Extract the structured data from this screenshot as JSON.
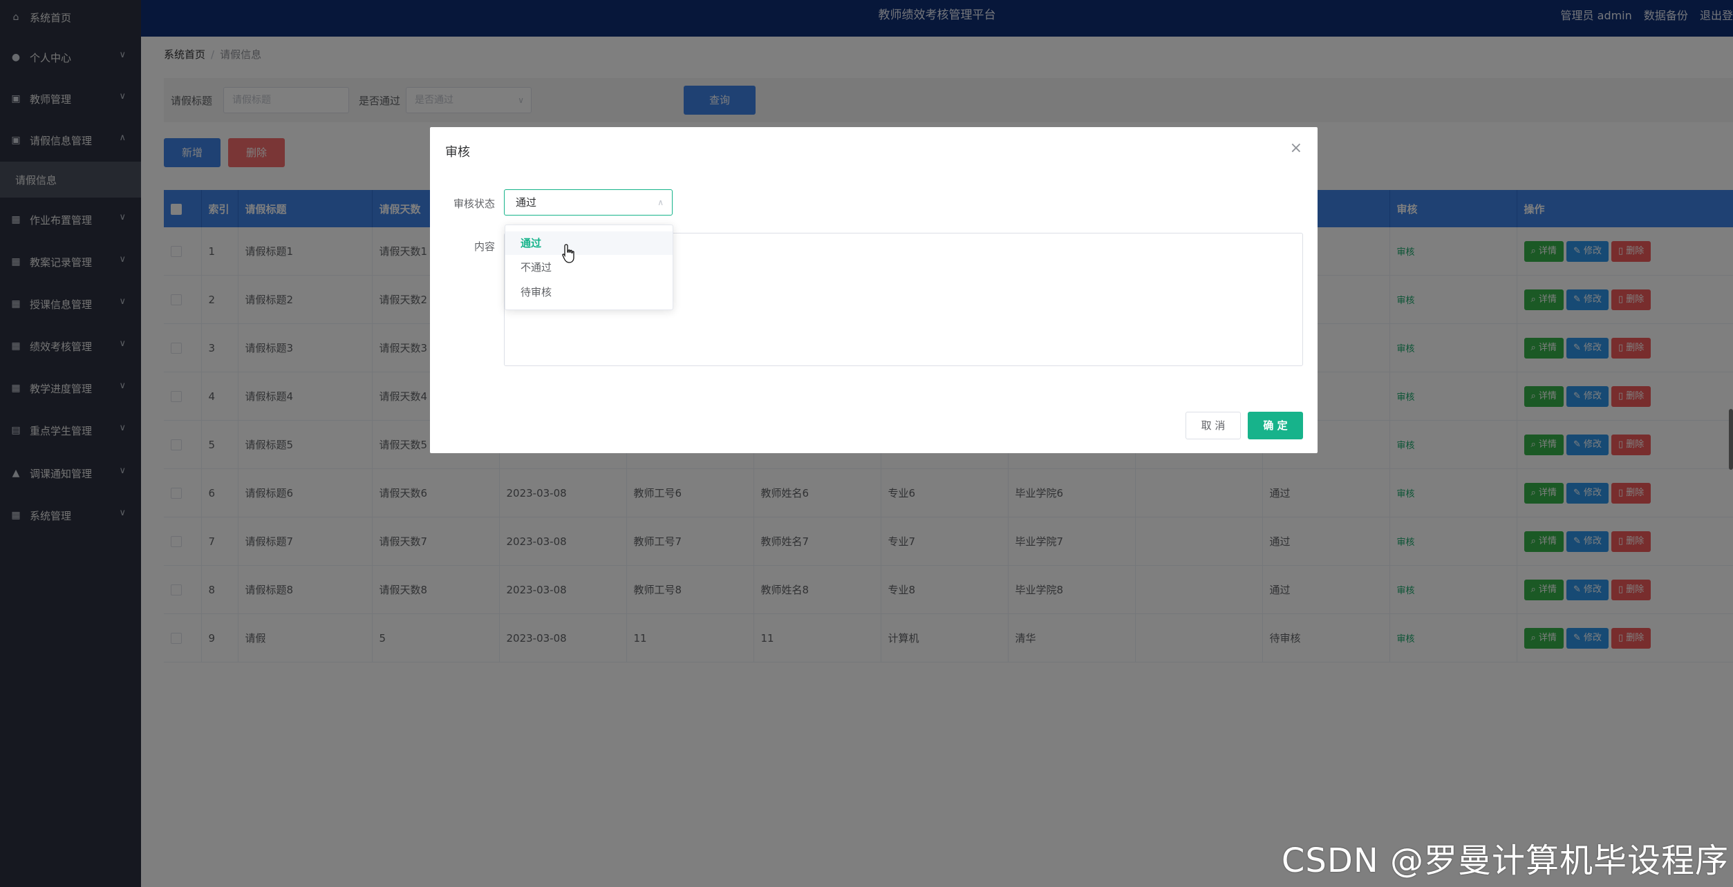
{
  "app": {
    "title": "教师绩效考核管理平台",
    "user_label": "管理员 admin",
    "backup_label": "数据备份",
    "logout_label": "退出登"
  },
  "sidebar": {
    "items": [
      {
        "label": "系统首页",
        "icon": "home-icon"
      },
      {
        "label": "个人中心",
        "icon": "user-icon"
      },
      {
        "label": "教师管理",
        "icon": "clipboard-icon"
      },
      {
        "label": "请假信息管理",
        "icon": "clipboard-icon"
      },
      {
        "label": "作业布置管理",
        "icon": "grid-icon"
      },
      {
        "label": "教案记录管理",
        "icon": "grid-icon"
      },
      {
        "label": "授课信息管理",
        "icon": "grid-icon"
      },
      {
        "label": "绩效考核管理",
        "icon": "grid-icon"
      },
      {
        "label": "教学进度管理",
        "icon": "grid-icon"
      },
      {
        "label": "重点学生管理",
        "icon": "chart-icon"
      },
      {
        "label": "调课通知管理",
        "icon": "thumb-icon"
      },
      {
        "label": "系统管理",
        "icon": "grid-icon"
      }
    ],
    "active_sub": "请假信息"
  },
  "breadcrumb": {
    "home": "系统首页",
    "current": "请假信息"
  },
  "search": {
    "title_label": "请假标题",
    "title_placeholder": "请假标题",
    "pass_label": "是否通过",
    "pass_placeholder": "是否通过",
    "query_label": "查询"
  },
  "toolbar": {
    "add_label": "新增",
    "delete_label": "删除"
  },
  "table": {
    "headers": {
      "index": "索引",
      "title": "请假标题",
      "days": "请假天数",
      "date": "",
      "teacher_no": "",
      "teacher_name": "",
      "major": "",
      "college": "",
      "col9": "",
      "status": "",
      "audit": "审核",
      "ops": "操作"
    },
    "audit_link": "审核",
    "ops": {
      "detail": "详情",
      "edit": "修改",
      "remove": "删除"
    },
    "rows": [
      {
        "index": "1",
        "title": "请假标题1",
        "days": "请假天数1",
        "date": "",
        "teacher_no": "",
        "teacher_name": "",
        "major": "",
        "college": "",
        "col9": "",
        "status": ""
      },
      {
        "index": "2",
        "title": "请假标题2",
        "days": "请假天数2",
        "date": "",
        "teacher_no": "",
        "teacher_name": "",
        "major": "",
        "college": "",
        "col9": "",
        "status": ""
      },
      {
        "index": "3",
        "title": "请假标题3",
        "days": "请假天数3",
        "date": "",
        "teacher_no": "",
        "teacher_name": "",
        "major": "",
        "college": "",
        "col9": "",
        "status": ""
      },
      {
        "index": "4",
        "title": "请假标题4",
        "days": "请假天数4",
        "date": "",
        "teacher_no": "",
        "teacher_name": "",
        "major": "",
        "college": "",
        "col9": "",
        "status": ""
      },
      {
        "index": "5",
        "title": "请假标题5",
        "days": "请假天数5",
        "date": "",
        "teacher_no": "",
        "teacher_name": "",
        "major": "",
        "college": "",
        "col9": "",
        "status": ""
      },
      {
        "index": "6",
        "title": "请假标题6",
        "days": "请假天数6",
        "date": "2023-03-08",
        "teacher_no": "教师工号6",
        "teacher_name": "教师姓名6",
        "major": "专业6",
        "college": "毕业学院6",
        "col9": "",
        "status": "通过"
      },
      {
        "index": "7",
        "title": "请假标题7",
        "days": "请假天数7",
        "date": "2023-03-08",
        "teacher_no": "教师工号7",
        "teacher_name": "教师姓名7",
        "major": "专业7",
        "college": "毕业学院7",
        "col9": "",
        "status": "通过"
      },
      {
        "index": "8",
        "title": "请假标题8",
        "days": "请假天数8",
        "date": "2023-03-08",
        "teacher_no": "教师工号8",
        "teacher_name": "教师姓名8",
        "major": "专业8",
        "college": "毕业学院8",
        "col9": "",
        "status": "通过"
      },
      {
        "index": "9",
        "title": "请假",
        "days": "5",
        "date": "2023-03-08",
        "teacher_no": "11",
        "teacher_name": "11",
        "major": "计算机",
        "college": "清华",
        "col9": "",
        "status": "待审核"
      }
    ]
  },
  "dialog": {
    "title": "审核",
    "close_icon": "close-icon",
    "status_label": "审核状态",
    "status_value": "通过",
    "content_label": "内容",
    "content_value": "",
    "cancel_label": "取 消",
    "ok_label": "确 定",
    "accent_color": "#15b38a"
  },
  "dropdown": {
    "options": [
      "通过",
      "不通过",
      "待审核"
    ],
    "selected": "通过"
  },
  "watermark": "CSDN @罗曼计算机毕设程序"
}
